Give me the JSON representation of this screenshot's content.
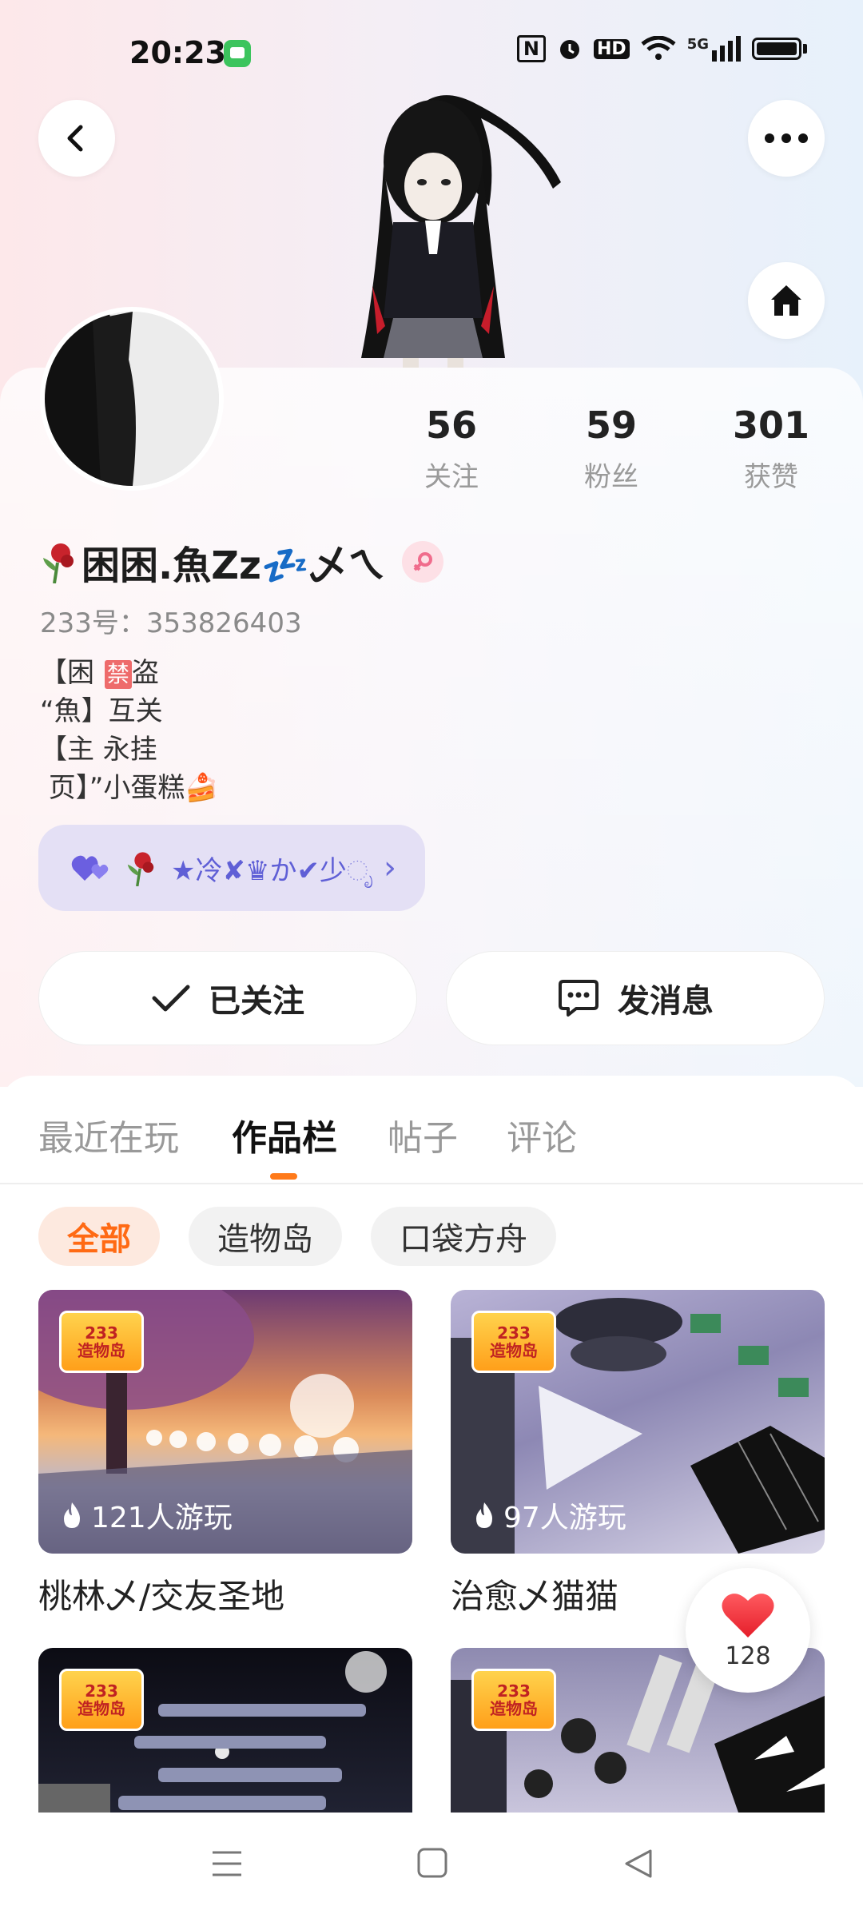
{
  "status_bar": {
    "time": "20:23",
    "icons": [
      "message-app-icon",
      "nfc-icon",
      "alarm-icon",
      "hd-icon",
      "wifi-icon",
      "5g-signal-icon",
      "battery-icon"
    ],
    "nfc_text": "N",
    "hd_text": "HD",
    "network_text": "5G"
  },
  "header": {
    "back_icon": "chevron-left-icon",
    "more_icon": "more-dots-icon",
    "home_icon": "home-icon"
  },
  "stats": [
    {
      "value": "56",
      "label": "关注"
    },
    {
      "value": "59",
      "label": "粉丝"
    },
    {
      "value": "301",
      "label": "获赞"
    }
  ],
  "profile": {
    "nickname": "困困.魚Zz💤乄ㄟ",
    "user_id": "233号：353826403",
    "bio_lines": [
      "【困 ",
      "“魚】互关",
      "【主 永挂",
      " 页】”小蛋糕🍰"
    ],
    "bio_ban_badge": "禁",
    "bio_line1_suffix": "盗"
  },
  "follow_chip": {
    "label": "★冷✘♛か✔少ೃ",
    "icon": "double-heart-icon"
  },
  "actions": {
    "followed_label": "已关注",
    "message_label": "发消息"
  },
  "tabs": [
    {
      "label": "最近在玩",
      "active": false
    },
    {
      "label": "作品栏",
      "active": true
    },
    {
      "label": "帖子",
      "active": false
    },
    {
      "label": "评论",
      "active": false
    }
  ],
  "filters": [
    {
      "label": "全部",
      "active": true
    },
    {
      "label": "造物岛",
      "active": false
    },
    {
      "label": "口袋方舟",
      "active": false
    }
  ],
  "cards": [
    {
      "title": "桃林乄/交友圣地",
      "plays": "121人游玩",
      "badge": "233\n造物岛"
    },
    {
      "title": "治愈乄猫猫",
      "plays": "97人游玩",
      "badge": "233\n造物岛"
    },
    {
      "title": "",
      "plays": "",
      "badge": "233\n造物岛"
    },
    {
      "title": "",
      "plays": "",
      "badge": "233\n造物岛"
    }
  ],
  "like_button": {
    "count": "128"
  },
  "colors": {
    "accent_orange": "#ff7a1a",
    "chip_purple": "#e4e0f5",
    "heart_red": "#f2323a"
  }
}
